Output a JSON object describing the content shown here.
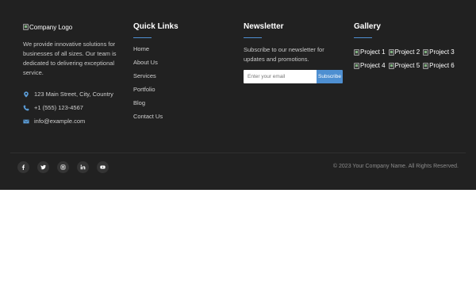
{
  "brand": {
    "logo_alt": "Company Logo",
    "description": "We provide innovative solutions for businesses of all sizes. Our team is dedicated to delivering exceptional service."
  },
  "contact": {
    "address": "123 Main Street, City, Country",
    "phone": "+1 (555) 123-4567",
    "email": "info@example.com",
    "icons": [
      "map-marker-icon",
      "phone-icon",
      "envelope-icon"
    ]
  },
  "quick_links": {
    "title": "Quick Links",
    "items": [
      "Home",
      "About Us",
      "Services",
      "Portfolio",
      "Blog",
      "Contact Us"
    ]
  },
  "newsletter": {
    "title": "Newsletter",
    "text": "Subscribe to our newsletter for updates and promotions.",
    "placeholder": "Enter your email",
    "value": "",
    "button_label": "Subscribe"
  },
  "gallery": {
    "title": "Gallery",
    "items": [
      "Project 1",
      "Project 2",
      "Project 3",
      "Project 4",
      "Project 5",
      "Project 6"
    ]
  },
  "social": {
    "icons": [
      "facebook-icon",
      "twitter-icon",
      "instagram-icon",
      "linkedin-icon",
      "youtube-icon"
    ]
  },
  "copyright": "© 2023 Your Company Name. All Rights Reserved.",
  "colors": {
    "footer_bg": "#212121",
    "accent": "#4e8fd1",
    "page_bg": "#ffffff"
  }
}
